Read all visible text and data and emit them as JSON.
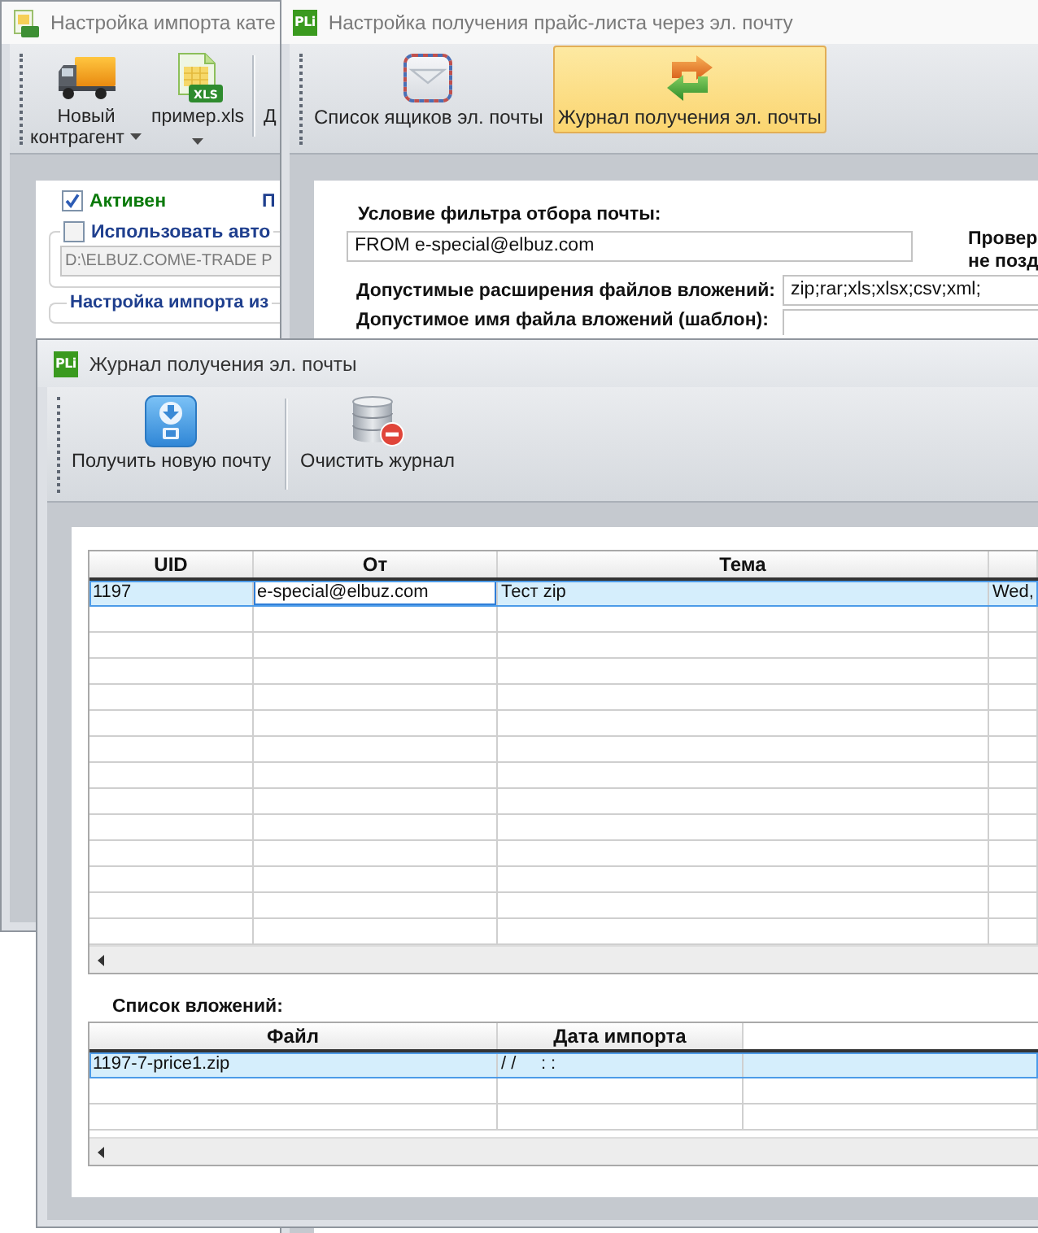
{
  "import_window": {
    "title": "Настройка импорта кате",
    "active": false,
    "toolbar": [
      {
        "label": "Новый контрагент",
        "kind": "dropdown"
      },
      {
        "label": "пример.xls",
        "kind": "split",
        "badge": "XLS"
      },
      {
        "label": "Д",
        "kind": "plain"
      }
    ],
    "active_checkbox": {
      "label": "Активен",
      "checked": true
    },
    "column_2_label": "П",
    "auto_checkbox": {
      "label": "Использовать авто",
      "checked": false
    },
    "path_field": {
      "value": "D:\\ELBUZ.COM\\E-TRADE P",
      "disabled": true
    },
    "group_title": "Настройка импорта из"
  },
  "mail_settings_window": {
    "logo": "PLi",
    "title": "Настройка получения прайс-листа через эл. почту",
    "active": false,
    "toolbar": [
      {
        "label": "Список ящиков эл. почты",
        "selected": false
      },
      {
        "label": "Журнал получения эл. почты",
        "selected": true
      }
    ],
    "filter": {
      "label": "Условие фильтра отбора почты:",
      "value": "FROM e-special@elbuz.com"
    },
    "side_label_lines": [
      "Провер",
      "не позд"
    ],
    "extensions": {
      "label": "Допустимые расширения файлов вложений:",
      "value": "zip;rar;xls;xlsx;csv;xml;"
    },
    "filename_template": {
      "label": "Допустимое имя файла вложений (шаблон):"
    }
  },
  "mail_log_window": {
    "logo": "PLi",
    "title": "Журнал получения эл. почты",
    "active": true,
    "toolbar": [
      {
        "label": "Получить новую почту"
      },
      {
        "label": "Очистить журнал"
      }
    ],
    "messages": {
      "columns": [
        "UID",
        "От",
        "Тема"
      ],
      "rows": [
        {
          "selected": true,
          "cells": [
            {
              "text": "1197",
              "focused": false
            },
            {
              "text": "e-special@elbuz.com",
              "focused": true
            },
            {
              "text": "Тест zip",
              "focused": false
            },
            {
              "text": "Wed,",
              "focused": false
            }
          ]
        }
      ]
    },
    "attachments": {
      "label": "Список вложений:",
      "columns": [
        "Файл",
        "Дата импорта"
      ],
      "rows": [
        {
          "selected": true,
          "cells": [
            "1197-7-price1.zip",
            "/ /     : :"
          ]
        }
      ]
    }
  }
}
